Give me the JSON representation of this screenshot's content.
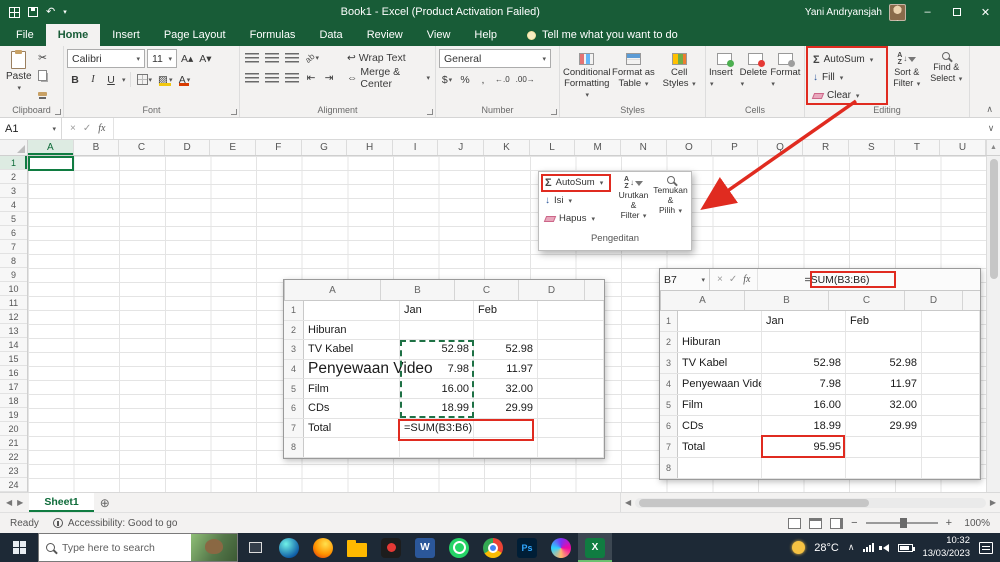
{
  "colors": {
    "title_green": "#185C37",
    "accent_green": "#107C41",
    "annotation_red": "#E02B20"
  },
  "title_bar": {
    "title": "Book1 - Excel (Product Activation Failed)",
    "user_name": "Yani Andryansjah"
  },
  "ribbon_tabs": {
    "items": [
      {
        "label": "File",
        "active": false
      },
      {
        "label": "Home",
        "active": true
      },
      {
        "label": "Insert",
        "active": false
      },
      {
        "label": "Page Layout",
        "active": false
      },
      {
        "label": "Formulas",
        "active": false
      },
      {
        "label": "Data",
        "active": false
      },
      {
        "label": "Review",
        "active": false
      },
      {
        "label": "View",
        "active": false
      },
      {
        "label": "Help",
        "active": false
      }
    ],
    "tell_me": "Tell me what you want to do"
  },
  "ribbon": {
    "clipboard": {
      "group_label": "Clipboard",
      "paste_label": "Paste"
    },
    "font": {
      "group_label": "Font",
      "family": "Calibri",
      "size": "11"
    },
    "alignment": {
      "group_label": "Alignment",
      "wrap_label": "Wrap Text",
      "merge_label": "Merge & Center"
    },
    "number": {
      "group_label": "Number",
      "format": "General"
    },
    "styles": {
      "group_label": "Styles",
      "conditional_line1": "Conditional",
      "conditional_line2": "Formatting",
      "table_line1": "Format as",
      "table_line2": "Table",
      "cell_line1": "Cell",
      "cell_line2": "Styles"
    },
    "cells": {
      "group_label": "Cells",
      "insert_label": "Insert",
      "delete_label": "Delete",
      "format_label": "Format"
    },
    "editing": {
      "group_label": "Editing",
      "autosum_label": "AutoSum",
      "fill_label": "Fill",
      "clear_label": "Clear",
      "sort_line1": "Sort &",
      "sort_line2": "Filter",
      "find_line1": "Find &",
      "find_line2": "Select"
    }
  },
  "formula_bar": {
    "name_box": "A1",
    "fx_label": "fx",
    "formula": ""
  },
  "grid": {
    "columns": [
      "A",
      "B",
      "C",
      "D",
      "E",
      "F",
      "G",
      "H",
      "I",
      "J",
      "K",
      "L",
      "M",
      "N",
      "O",
      "P",
      "Q",
      "R",
      "S",
      "T",
      "U"
    ],
    "row_count": 24
  },
  "popup": {
    "autosum_label": "AutoSum",
    "fill_label": "Isi",
    "clear_label": "Hapus",
    "sort_line1": "Urutkan &",
    "sort_line2": "Filter",
    "find_line1": "Temukan &",
    "find_line2": "Pilih",
    "group_label": "Pengeditan"
  },
  "left_table": {
    "col_headers": [
      "A",
      "B",
      "C",
      "D"
    ],
    "rows": [
      {
        "n": "1",
        "A": "",
        "B": "Jan",
        "C": "Feb",
        "D": ""
      },
      {
        "n": "2",
        "A": "Hiburan",
        "B": "",
        "C": "",
        "D": ""
      },
      {
        "n": "3",
        "A": "TV Kabel",
        "B": "52.98",
        "C": "52.98",
        "D": ""
      },
      {
        "n": "4",
        "A": "Penyewaan Video",
        "B": "7.98",
        "C": "11.97",
        "D": ""
      },
      {
        "n": "5",
        "A": "Film",
        "B": "16.00",
        "C": "32.00",
        "D": ""
      },
      {
        "n": "6",
        "A": "CDs",
        "B": "18.99",
        "C": "29.99",
        "D": ""
      },
      {
        "n": "7",
        "A": "Total",
        "B": "=SUM(B3:B6)",
        "C": "",
        "D": ""
      },
      {
        "n": "8",
        "A": "",
        "B": "",
        "C": "",
        "D": ""
      }
    ]
  },
  "right_table": {
    "name_box": "B7",
    "fx_label": "fx",
    "formula": "=SUM(B3:B6)",
    "col_headers": [
      "A",
      "B",
      "C",
      "D"
    ],
    "rows": [
      {
        "n": "1",
        "A": "",
        "B": "Jan",
        "C": "Feb",
        "D": ""
      },
      {
        "n": "2",
        "A": "Hiburan",
        "B": "",
        "C": "",
        "D": ""
      },
      {
        "n": "3",
        "A": "TV Kabel",
        "B": "52.98",
        "C": "52.98",
        "D": ""
      },
      {
        "n": "4",
        "A": "Penyewaan Video",
        "B": "7.98",
        "C": "11.97",
        "D": ""
      },
      {
        "n": "5",
        "A": "Film",
        "B": "16.00",
        "C": "32.00",
        "D": ""
      },
      {
        "n": "6",
        "A": "CDs",
        "B": "18.99",
        "C": "29.99",
        "D": ""
      },
      {
        "n": "7",
        "A": "Total",
        "B": "95.95",
        "C": "",
        "D": ""
      },
      {
        "n": "8",
        "A": "",
        "B": "",
        "C": "",
        "D": ""
      }
    ]
  },
  "sheet_bar": {
    "active_tab": "Sheet1"
  },
  "status_bar": {
    "ready_label": "Ready",
    "accessibility_label": "Accessibility: Good to go",
    "zoom_level": "100%"
  },
  "taskbar": {
    "search_placeholder": "Type here to search",
    "temperature": "28°C",
    "time": "10:32",
    "date": "13/03/2023",
    "apps": [
      {
        "name": "edge",
        "active": false
      },
      {
        "name": "firefox",
        "active": false
      },
      {
        "name": "file-explorer",
        "active": false
      },
      {
        "name": "media-player",
        "active": false
      },
      {
        "name": "word",
        "active": false
      },
      {
        "name": "whatsapp",
        "active": false
      },
      {
        "name": "chrome",
        "active": false
      },
      {
        "name": "photoshop",
        "active": false
      },
      {
        "name": "browser",
        "active": false
      },
      {
        "name": "excel",
        "active": true
      }
    ]
  }
}
